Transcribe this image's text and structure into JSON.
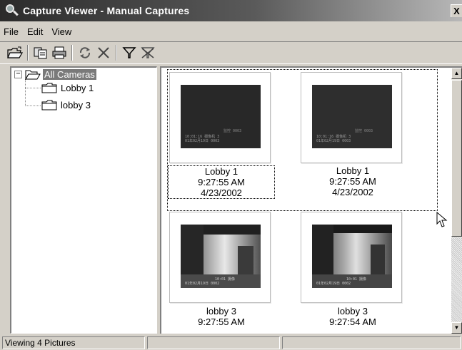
{
  "window": {
    "title": "Capture Viewer - Manual Captures",
    "close_label": "X"
  },
  "menu": [
    "File",
    "Edit",
    "View"
  ],
  "toolbar": [
    "open-icon",
    "copy-icon",
    "print-icon",
    "refresh-icon",
    "delete-icon",
    "filter-icon",
    "clear-filter-icon"
  ],
  "tree": {
    "root": {
      "label": "All Cameras",
      "expander": "−",
      "selected": true
    },
    "children": [
      {
        "label": "Lobby 1"
      },
      {
        "label": "lobby 3"
      }
    ]
  },
  "thumbnails": [
    {
      "camera": "Lobby 1",
      "time": "9:27:55 AM",
      "date": "4/23/2002",
      "focused": true
    },
    {
      "camera": "Lobby 1",
      "time": "9:27:55 AM",
      "date": "4/23/2002",
      "focused": false
    },
    {
      "camera": "lobby 3",
      "time": "9:27:55 AM",
      "date": "",
      "focused": false
    },
    {
      "camera": "lobby 3",
      "time": "9:27:54 AM",
      "date": "",
      "focused": false
    }
  ],
  "status": {
    "text": "Viewing 4 Pictures"
  },
  "colors": {
    "titlebar_dark": "#2b2b2b",
    "window_face": "#d4d0c8",
    "selection": "#7a7a7a"
  }
}
